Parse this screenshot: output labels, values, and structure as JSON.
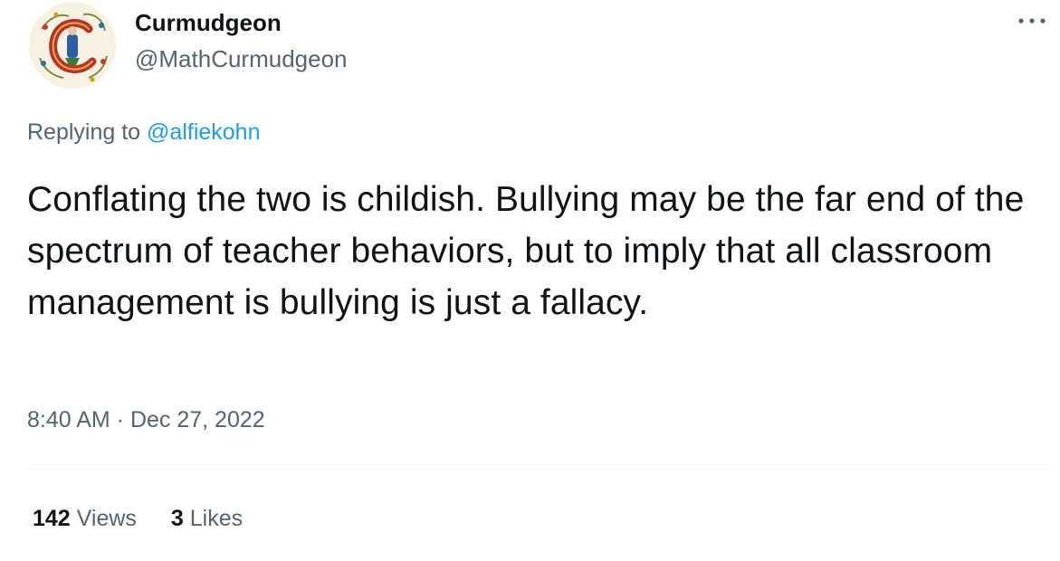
{
  "author": {
    "display_name": "Curmudgeon",
    "handle": "@MathCurmudgeon",
    "avatar_icon": "illuminated-letter-c-icon"
  },
  "more_icon": "more-horizontal-icon",
  "reply": {
    "prefix": "Replying to ",
    "mention": "@alfiekohn"
  },
  "tweet": {
    "text": "Conflating the two is childish. Bullying may be the far end of the spectrum of teacher behaviors, but to imply that all classroom management is bullying is just a fallacy.",
    "time": "8:40 AM",
    "separator": " · ",
    "date": "Dec 27, 2022"
  },
  "stats": {
    "views_count": "142",
    "views_label": " Views",
    "likes_count": "3",
    "likes_label": " Likes"
  },
  "colors": {
    "text_primary": "#0f1419",
    "text_secondary": "#536471",
    "link": "#1d9bf0",
    "divider": "#eff3f4"
  }
}
